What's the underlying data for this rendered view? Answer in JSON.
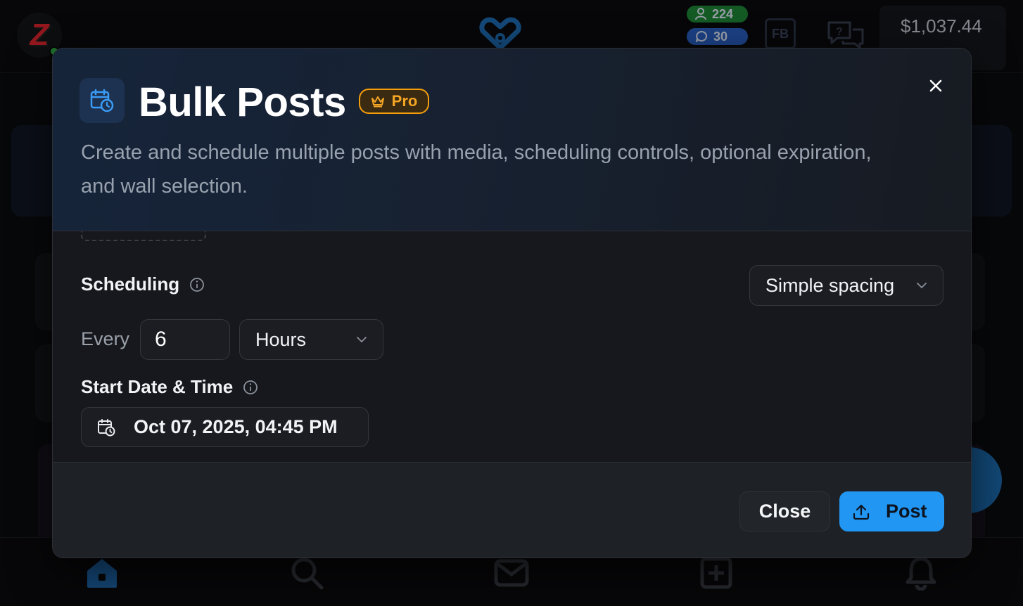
{
  "background": {
    "avatar_letter": "Z",
    "followers_count": "224",
    "comments_count": "30",
    "fb_label": "FB",
    "balance": "$1,037.44"
  },
  "modal": {
    "title": "Bulk Posts",
    "badge_label": "Pro",
    "description": "Create and schedule multiple posts with media, scheduling controls, optional expiration, and wall selection.",
    "scheduling": {
      "label": "Scheduling",
      "mode_selected": "Simple spacing",
      "every_label": "Every",
      "interval_value": "6",
      "interval_unit": "Hours"
    },
    "start": {
      "label": "Start Date & Time",
      "value": "Oct 07, 2025, 04:45 PM"
    },
    "footer": {
      "close_label": "Close",
      "post_label": "Post"
    }
  },
  "colors": {
    "accent": "#2196f3",
    "pro": "#f5a524",
    "followers_badge": "#1f8a3a",
    "comments_badge": "#2b63c9"
  },
  "icons": {
    "header": "calendar-clock-icon",
    "pro": "crown-icon",
    "close": "close-icon",
    "info": "info-icon",
    "dropdown": "chevron-down-icon",
    "date": "calendar-clock-icon",
    "post": "upload-icon",
    "nav": [
      "home-icon",
      "search-icon",
      "mail-icon",
      "add-square-icon",
      "bell-icon"
    ]
  }
}
